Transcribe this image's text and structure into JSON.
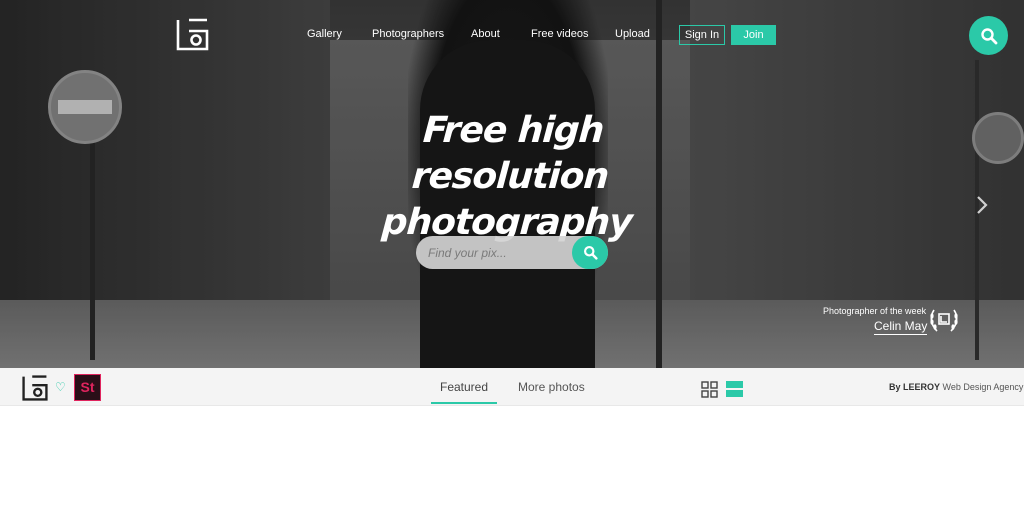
{
  "nav": {
    "links": [
      "Gallery",
      "Photographers",
      "About",
      "Free videos",
      "Upload"
    ],
    "signin_label": "Sign In",
    "join_label": "Join"
  },
  "hero": {
    "headline_line1": "Free high resolution",
    "headline_line2": "photography",
    "search_placeholder": "Find your pix..."
  },
  "photographer_of_week": {
    "label": "Photographer of the week",
    "name": "Celin May"
  },
  "bottom_bar": {
    "badge_text": "St",
    "tabs": [
      "Featured",
      "More photos"
    ],
    "active_tab": "Featured",
    "credit_brand": "By LEEROY",
    "credit_rest": " Web Design Agency"
  },
  "colors": {
    "accent": "#2bc9a8",
    "bar_background": "#f4f4f4",
    "badge_border": "#e0245e"
  },
  "icons": [
    "logo-icon",
    "search-icon",
    "chevron-right-icon",
    "laurel-icon",
    "heart-icon",
    "grid-view-icon",
    "list-view-icon"
  ]
}
